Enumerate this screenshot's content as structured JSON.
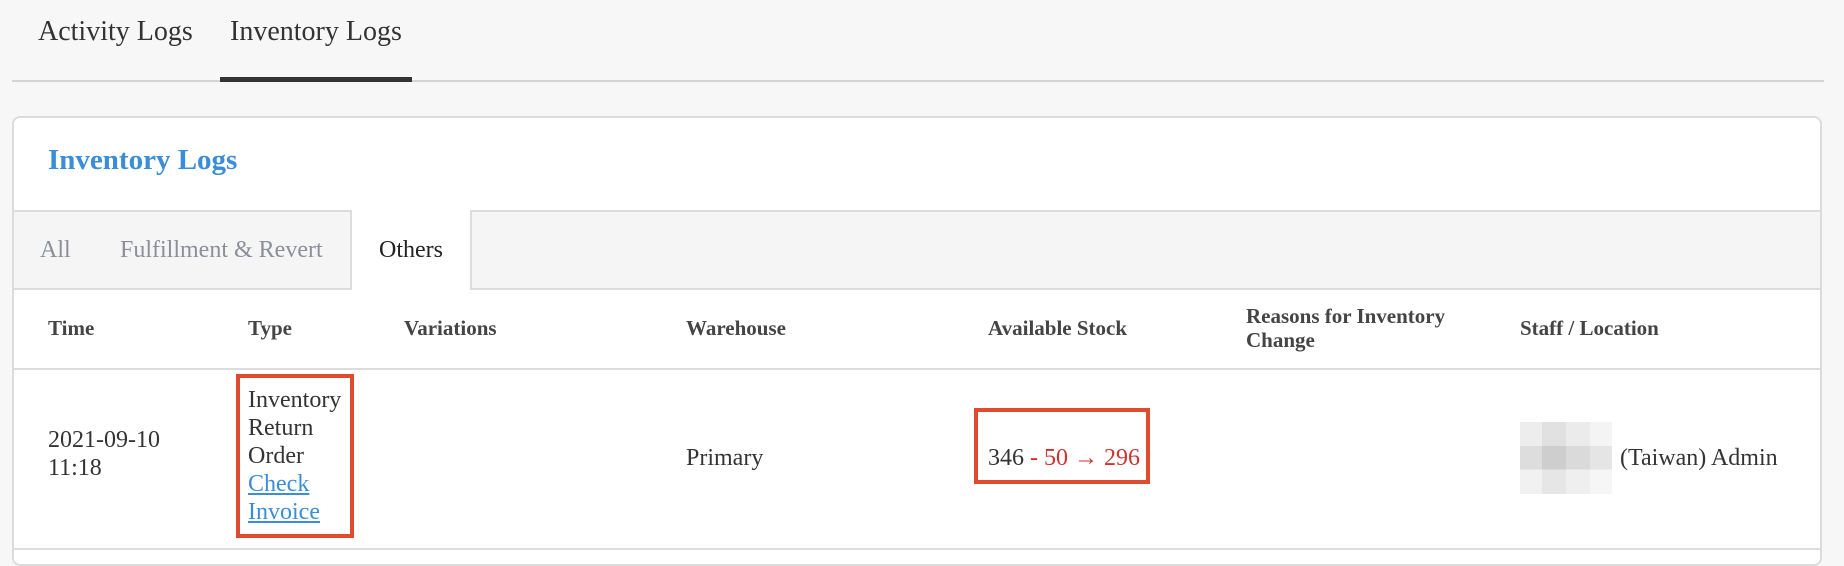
{
  "top_tabs": [
    {
      "label": "Activity Logs"
    },
    {
      "label": "Inventory Logs",
      "active": true
    }
  ],
  "card": {
    "title": "Inventory Logs",
    "sub_tabs": [
      {
        "label": "All"
      },
      {
        "label": "Fulfillment & Revert"
      },
      {
        "label": "Others",
        "active": true
      }
    ]
  },
  "table": {
    "headers": {
      "time": "Time",
      "type": "Type",
      "variations": "Variations",
      "warehouse": "Warehouse",
      "stock": "Available Stock",
      "reason": "Reasons for Inventory Change",
      "staff": "Staff / Location"
    },
    "rows": [
      {
        "time": "2021-09-10 11:18",
        "type": "Inventory Return Order",
        "link": "Check Invoice",
        "variations": "",
        "warehouse": "Primary",
        "stock_before": "346",
        "stock_delta": "- 50 → 296",
        "reason": "",
        "staff": "(Taiwan) Admin"
      }
    ]
  },
  "colors": {
    "accent_blue": "#3a8ed8",
    "highlight_red": "#e04a2e",
    "delta_red": "#d0312d"
  }
}
